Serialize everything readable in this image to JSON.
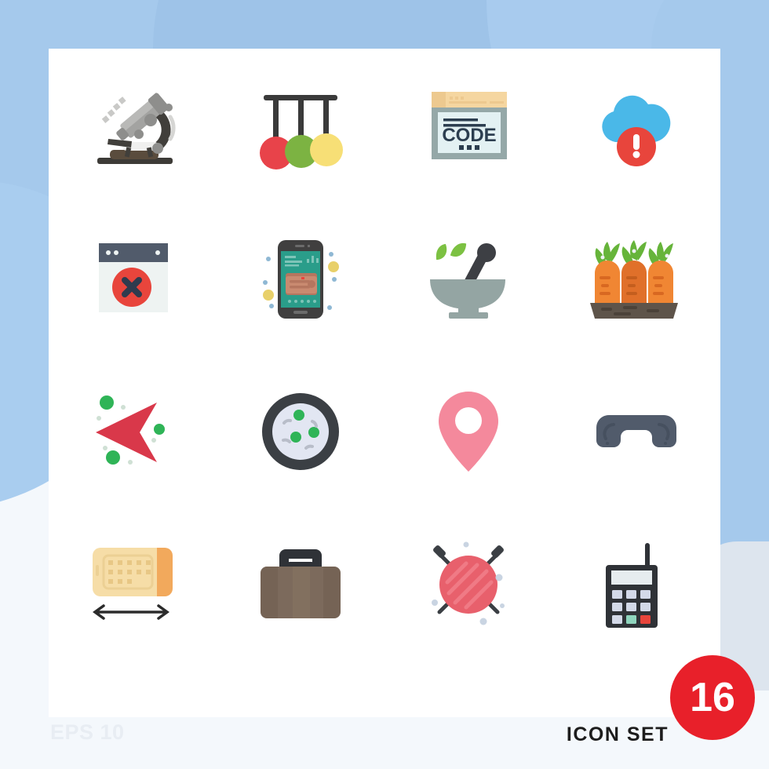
{
  "page": {
    "background_color": "#f4f8fc",
    "card_color": "#ffffff",
    "accent_color": "#e8202a",
    "blob_color": "#a5c9ec"
  },
  "footer": {
    "eps_label": "EPS 10",
    "set_label": "ICON SET",
    "badge_count": "16"
  },
  "icons": [
    {
      "name": "microscope-icon",
      "label": "Microscope"
    },
    {
      "name": "newtons-cradle-icon",
      "label": "Newtons cradle pendulum"
    },
    {
      "name": "code-browser-icon",
      "label": "Code browser window",
      "text": "CODE"
    },
    {
      "name": "cloud-alert-icon",
      "label": "Cloud error alert"
    },
    {
      "name": "browser-error-icon",
      "label": "Browser window error"
    },
    {
      "name": "mobile-wallet-icon",
      "label": "Mobile payment wallet"
    },
    {
      "name": "mortar-pestle-icon",
      "label": "Mortar and pestle herbs"
    },
    {
      "name": "carrots-icon",
      "label": "Carrots growing in soil"
    },
    {
      "name": "cursor-arrow-icon",
      "label": "Arrow cursor pointer"
    },
    {
      "name": "petri-dish-icon",
      "label": "Petri dish bacteria"
    },
    {
      "name": "location-pin-icon",
      "label": "Map location pin"
    },
    {
      "name": "phone-handset-icon",
      "label": "Telephone handset"
    },
    {
      "name": "blueprint-width-icon",
      "label": "Blueprint width measure"
    },
    {
      "name": "briefcase-icon",
      "label": "Briefcase"
    },
    {
      "name": "yarn-knitting-icon",
      "label": "Yarn ball with knitting needles"
    },
    {
      "name": "mobile-phone-antenna-icon",
      "label": "Mobile phone with antenna"
    }
  ]
}
